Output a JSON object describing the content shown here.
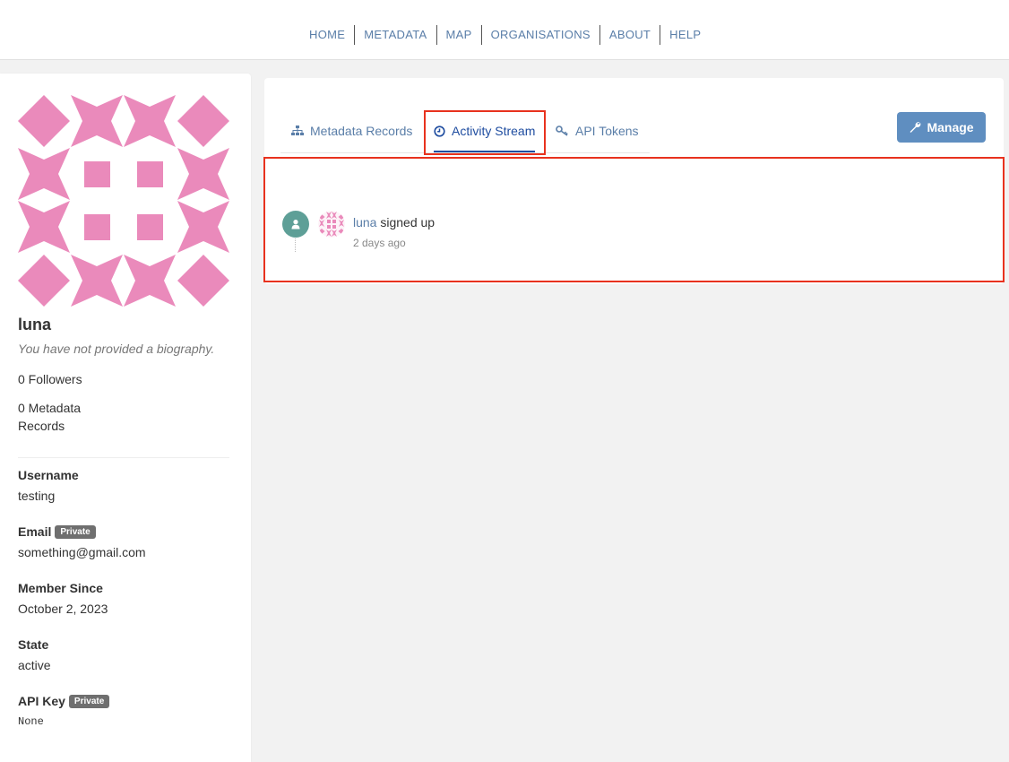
{
  "nav": {
    "items": [
      "HOME",
      "METADATA",
      "MAP",
      "ORGANISATIONS",
      "ABOUT",
      "HELP"
    ]
  },
  "profile": {
    "name": "luna",
    "bio": "You have not provided a biography.",
    "followers": "0 Followers",
    "records": "0 Metadata Records",
    "fields": {
      "username_label": "Username",
      "username_value": "testing",
      "email_label": "Email",
      "email_badge": "Private",
      "email_value": "something@gmail.com",
      "member_label": "Member Since",
      "member_value": "October 2, 2023",
      "state_label": "State",
      "state_value": "active",
      "apikey_label": "API Key",
      "apikey_badge": "Private",
      "apikey_value": "None"
    },
    "avatar_color": "#ea8abb"
  },
  "tabs": [
    {
      "label": "Metadata Records",
      "icon": "sitemap-icon"
    },
    {
      "label": "Activity Stream",
      "icon": "clock-icon",
      "active": true
    },
    {
      "label": "API Tokens",
      "icon": "key-icon"
    }
  ],
  "manage_button": {
    "label": "Manage",
    "icon": "wrench-icon"
  },
  "activity": {
    "user": "luna",
    "action": " signed up",
    "time": "2 days ago",
    "icon": "user-icon",
    "icon_color": "#5e9f97"
  },
  "colors": {
    "link": "#5a7ea8",
    "active_tab": "#1f4da0",
    "button": "#5f8ec0",
    "highlight": "#e8321e"
  }
}
